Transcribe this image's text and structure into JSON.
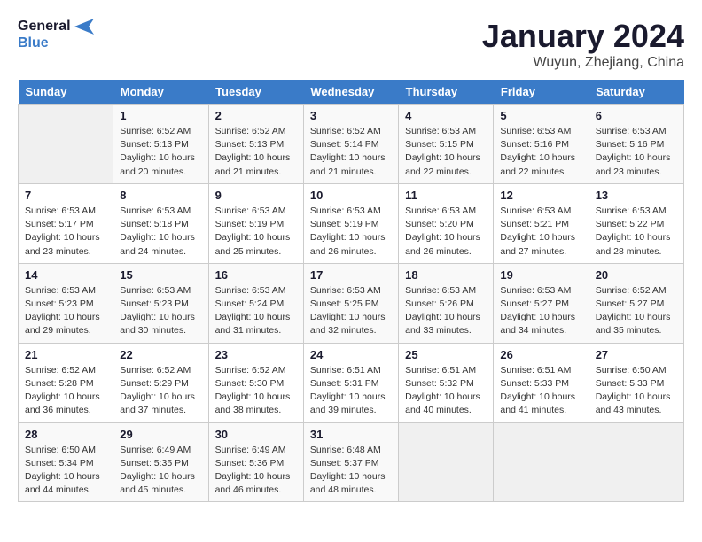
{
  "header": {
    "logo_line1": "General",
    "logo_line2": "Blue",
    "month": "January 2024",
    "location": "Wuyun, Zhejiang, China"
  },
  "weekdays": [
    "Sunday",
    "Monday",
    "Tuesday",
    "Wednesday",
    "Thursday",
    "Friday",
    "Saturday"
  ],
  "weeks": [
    [
      {
        "day": "",
        "info": ""
      },
      {
        "day": "1",
        "info": "Sunrise: 6:52 AM\nSunset: 5:13 PM\nDaylight: 10 hours\nand 20 minutes."
      },
      {
        "day": "2",
        "info": "Sunrise: 6:52 AM\nSunset: 5:13 PM\nDaylight: 10 hours\nand 21 minutes."
      },
      {
        "day": "3",
        "info": "Sunrise: 6:52 AM\nSunset: 5:14 PM\nDaylight: 10 hours\nand 21 minutes."
      },
      {
        "day": "4",
        "info": "Sunrise: 6:53 AM\nSunset: 5:15 PM\nDaylight: 10 hours\nand 22 minutes."
      },
      {
        "day": "5",
        "info": "Sunrise: 6:53 AM\nSunset: 5:16 PM\nDaylight: 10 hours\nand 22 minutes."
      },
      {
        "day": "6",
        "info": "Sunrise: 6:53 AM\nSunset: 5:16 PM\nDaylight: 10 hours\nand 23 minutes."
      }
    ],
    [
      {
        "day": "7",
        "info": "Sunrise: 6:53 AM\nSunset: 5:17 PM\nDaylight: 10 hours\nand 23 minutes."
      },
      {
        "day": "8",
        "info": "Sunrise: 6:53 AM\nSunset: 5:18 PM\nDaylight: 10 hours\nand 24 minutes."
      },
      {
        "day": "9",
        "info": "Sunrise: 6:53 AM\nSunset: 5:19 PM\nDaylight: 10 hours\nand 25 minutes."
      },
      {
        "day": "10",
        "info": "Sunrise: 6:53 AM\nSunset: 5:19 PM\nDaylight: 10 hours\nand 26 minutes."
      },
      {
        "day": "11",
        "info": "Sunrise: 6:53 AM\nSunset: 5:20 PM\nDaylight: 10 hours\nand 26 minutes."
      },
      {
        "day": "12",
        "info": "Sunrise: 6:53 AM\nSunset: 5:21 PM\nDaylight: 10 hours\nand 27 minutes."
      },
      {
        "day": "13",
        "info": "Sunrise: 6:53 AM\nSunset: 5:22 PM\nDaylight: 10 hours\nand 28 minutes."
      }
    ],
    [
      {
        "day": "14",
        "info": "Sunrise: 6:53 AM\nSunset: 5:23 PM\nDaylight: 10 hours\nand 29 minutes."
      },
      {
        "day": "15",
        "info": "Sunrise: 6:53 AM\nSunset: 5:23 PM\nDaylight: 10 hours\nand 30 minutes."
      },
      {
        "day": "16",
        "info": "Sunrise: 6:53 AM\nSunset: 5:24 PM\nDaylight: 10 hours\nand 31 minutes."
      },
      {
        "day": "17",
        "info": "Sunrise: 6:53 AM\nSunset: 5:25 PM\nDaylight: 10 hours\nand 32 minutes."
      },
      {
        "day": "18",
        "info": "Sunrise: 6:53 AM\nSunset: 5:26 PM\nDaylight: 10 hours\nand 33 minutes."
      },
      {
        "day": "19",
        "info": "Sunrise: 6:53 AM\nSunset: 5:27 PM\nDaylight: 10 hours\nand 34 minutes."
      },
      {
        "day": "20",
        "info": "Sunrise: 6:52 AM\nSunset: 5:27 PM\nDaylight: 10 hours\nand 35 minutes."
      }
    ],
    [
      {
        "day": "21",
        "info": "Sunrise: 6:52 AM\nSunset: 5:28 PM\nDaylight: 10 hours\nand 36 minutes."
      },
      {
        "day": "22",
        "info": "Sunrise: 6:52 AM\nSunset: 5:29 PM\nDaylight: 10 hours\nand 37 minutes."
      },
      {
        "day": "23",
        "info": "Sunrise: 6:52 AM\nSunset: 5:30 PM\nDaylight: 10 hours\nand 38 minutes."
      },
      {
        "day": "24",
        "info": "Sunrise: 6:51 AM\nSunset: 5:31 PM\nDaylight: 10 hours\nand 39 minutes."
      },
      {
        "day": "25",
        "info": "Sunrise: 6:51 AM\nSunset: 5:32 PM\nDaylight: 10 hours\nand 40 minutes."
      },
      {
        "day": "26",
        "info": "Sunrise: 6:51 AM\nSunset: 5:33 PM\nDaylight: 10 hours\nand 41 minutes."
      },
      {
        "day": "27",
        "info": "Sunrise: 6:50 AM\nSunset: 5:33 PM\nDaylight: 10 hours\nand 43 minutes."
      }
    ],
    [
      {
        "day": "28",
        "info": "Sunrise: 6:50 AM\nSunset: 5:34 PM\nDaylight: 10 hours\nand 44 minutes."
      },
      {
        "day": "29",
        "info": "Sunrise: 6:49 AM\nSunset: 5:35 PM\nDaylight: 10 hours\nand 45 minutes."
      },
      {
        "day": "30",
        "info": "Sunrise: 6:49 AM\nSunset: 5:36 PM\nDaylight: 10 hours\nand 46 minutes."
      },
      {
        "day": "31",
        "info": "Sunrise: 6:48 AM\nSunset: 5:37 PM\nDaylight: 10 hours\nand 48 minutes."
      },
      {
        "day": "",
        "info": ""
      },
      {
        "day": "",
        "info": ""
      },
      {
        "day": "",
        "info": ""
      }
    ]
  ]
}
